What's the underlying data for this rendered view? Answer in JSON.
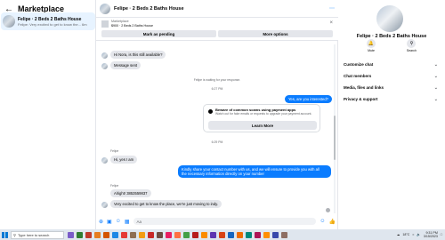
{
  "sidebar": {
    "title": "Marketplace",
    "conversation": {
      "name": "Felipe · 2 Beds 2 Baths House",
      "snippet": "Felipe: Very excited to get to know the... 6m"
    }
  },
  "chat": {
    "header_name": "Felipe · 2 Beds 2 Baths House",
    "listing": {
      "label": "Marketplace",
      "price_title": "$900 · 2 Beds 2 Baths House"
    },
    "buttons": {
      "mark_pending": "Mark as pending",
      "more_options": "More options"
    },
    "messages": {
      "m1": "Hi Nora, is this still available?",
      "m2": "Message sent",
      "waiting": "Felipe is waiting for your response.",
      "time1": "6:27 PM",
      "out1": "Yes, are you interested?",
      "time2": "6:29 PM",
      "sender1": "Felipe",
      "in1": "Hi, yes I am",
      "out2_line1": "Kindly share your contact number with us, and we will ensure to provide you with all",
      "out2_line2": "the necessary information directly on your number",
      "sender2": "Felipe",
      "in2": "Alright! 3853559837",
      "in3": "Very excited to get to know the place, we're just moving to indy."
    },
    "scam_card": {
      "title": "Beware of common scams using payment apps",
      "subtitle": "Watch out for fake emails or requests to upgrade your payment account.",
      "button": "Learn More"
    },
    "composer_placeholder": "Aa"
  },
  "details": {
    "name": "Felipe · 2 Beds 2 Baths House",
    "actions": [
      "Mute",
      "Search"
    ],
    "menu": [
      "Customize chat",
      "Chat members",
      "Media, files and links",
      "Privacy & support"
    ]
  },
  "taskbar": {
    "search_placeholder": "Type here to search",
    "weather": "18°C",
    "time": "9:31 PM",
    "date": "3/15/2023"
  },
  "colors": {
    "accent": "#0a7cff",
    "bubble_in": "#e4e6eb",
    "selected_conversation": "#e7f3ff"
  }
}
